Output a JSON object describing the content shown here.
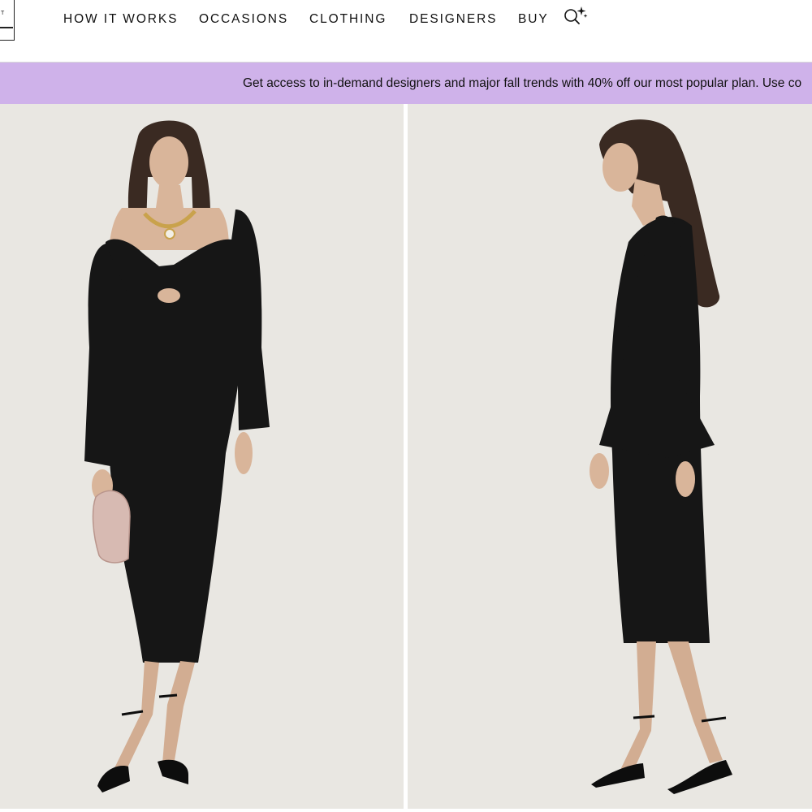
{
  "header": {
    "nav": [
      {
        "label": "HOW IT WORKS"
      },
      {
        "label": "OCCASIONS"
      },
      {
        "label": "CLOTHING"
      },
      {
        "label": "DESIGNERS"
      },
      {
        "label": "BUY"
      }
    ],
    "logo_letter": "T",
    "search_icon": "search-sparkle-icon"
  },
  "promo": {
    "text": "Get access to in-demand designers and major fall trends with 40% off our most popular plan. Use co"
  },
  "gallery": {
    "images": [
      {
        "view": "front",
        "subject": "model in black long-sleeve midi dress"
      },
      {
        "view": "side",
        "subject": "model in black long-sleeve midi dress"
      }
    ]
  },
  "colors": {
    "promo_bg": "#cfb2ea",
    "photo_bg": "#e9e7e2",
    "dress": "#161616"
  }
}
